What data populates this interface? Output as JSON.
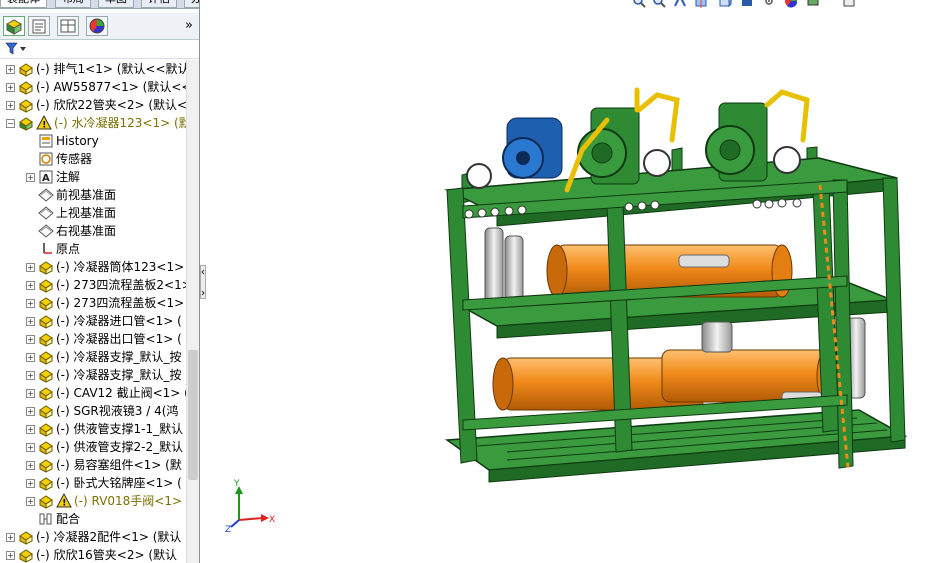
{
  "tabs": [
    "装配体",
    "布局",
    "草图",
    "评估",
    "办公室产品"
  ],
  "tree": [
    {
      "label": "(-) 排气1<1> (默认<<默认",
      "warn": false,
      "icon": "part-icon",
      "indent": 0
    },
    {
      "label": "(-) AW55877<1> (默认<<",
      "warn": false,
      "icon": "part-icon",
      "indent": 0
    },
    {
      "label": "(-) 欣欣22管夹<2> (默认<",
      "warn": false,
      "icon": "part-icon",
      "indent": 0
    },
    {
      "label": "(-) 水冷凝器123<1> (默",
      "warn": true,
      "icon": "assembly-icon",
      "indent": 0,
      "expanded": true
    },
    {
      "label": "History",
      "warn": false,
      "icon": "history-icon",
      "indent": 1
    },
    {
      "label": "传感器",
      "warn": false,
      "icon": "sensor-icon",
      "indent": 1
    },
    {
      "label": "注解",
      "warn": false,
      "icon": "annotation-icon",
      "indent": 1
    },
    {
      "label": "前视基准面",
      "warn": false,
      "icon": "plane-icon",
      "indent": 1
    },
    {
      "label": "上视基准面",
      "warn": false,
      "icon": "plane-icon",
      "indent": 1
    },
    {
      "label": "右视基准面",
      "warn": false,
      "icon": "plane-icon",
      "indent": 1
    },
    {
      "label": "原点",
      "warn": false,
      "icon": "origin-icon",
      "indent": 1
    },
    {
      "label": "(-) 冷凝器筒体123<1> (",
      "warn": false,
      "icon": "part-icon",
      "indent": 1
    },
    {
      "label": "(-) 273四流程盖板2<1>",
      "warn": false,
      "icon": "part-icon",
      "indent": 1
    },
    {
      "label": "(-) 273四流程盖板<1> (",
      "warn": false,
      "icon": "part-icon",
      "indent": 1
    },
    {
      "label": "(-) 冷凝器进口管<1> (",
      "warn": false,
      "icon": "part-icon",
      "indent": 1
    },
    {
      "label": "(-) 冷凝器出口管<1> (",
      "warn": false,
      "icon": "part-icon",
      "indent": 1
    },
    {
      "label": "(-) 冷凝器支撑_默认_按",
      "warn": false,
      "icon": "part-icon",
      "indent": 1
    },
    {
      "label": "(-) 冷凝器支撑_默认_按",
      "warn": false,
      "icon": "part-icon",
      "indent": 1
    },
    {
      "label": "(-) CAV12 截止阀<1> (",
      "warn": false,
      "icon": "part-icon",
      "indent": 1
    },
    {
      "label": "(-) SGR视液镜3 / 4(鸿",
      "warn": false,
      "icon": "part-icon",
      "indent": 1
    },
    {
      "label": "(-) 供液管支撑1-1_默认",
      "warn": false,
      "icon": "part-icon",
      "indent": 1
    },
    {
      "label": "(-) 供液管支撑2-2_默认",
      "warn": false,
      "icon": "part-icon",
      "indent": 1
    },
    {
      "label": "(-) 易容塞组件<1> (默",
      "warn": false,
      "icon": "part-icon",
      "indent": 1
    },
    {
      "label": "(-) 卧式大铭牌座<1> (",
      "warn": false,
      "icon": "part-icon",
      "indent": 1
    },
    {
      "label": "(-) RV018手阀<1>",
      "warn": true,
      "icon": "part-icon",
      "indent": 1
    },
    {
      "label": "配合",
      "warn": false,
      "icon": "mates-icon",
      "indent": 1
    },
    {
      "label": "(-) 冷凝器2配件<1> (默认",
      "warn": false,
      "icon": "part-icon",
      "indent": 0
    },
    {
      "label": "(-) 欣欣16管夹<2> (默认",
      "warn": false,
      "icon": "part-icon",
      "indent": 0
    }
  ],
  "triad": {
    "x": "X",
    "y": "Y",
    "z": "Z"
  },
  "colors": {
    "frame": "#2e8b34",
    "vessel": "#f08a1a",
    "motor": "#1f5fb0",
    "warning": "#e8c000",
    "tree_warn_text": "#7b6f00"
  }
}
